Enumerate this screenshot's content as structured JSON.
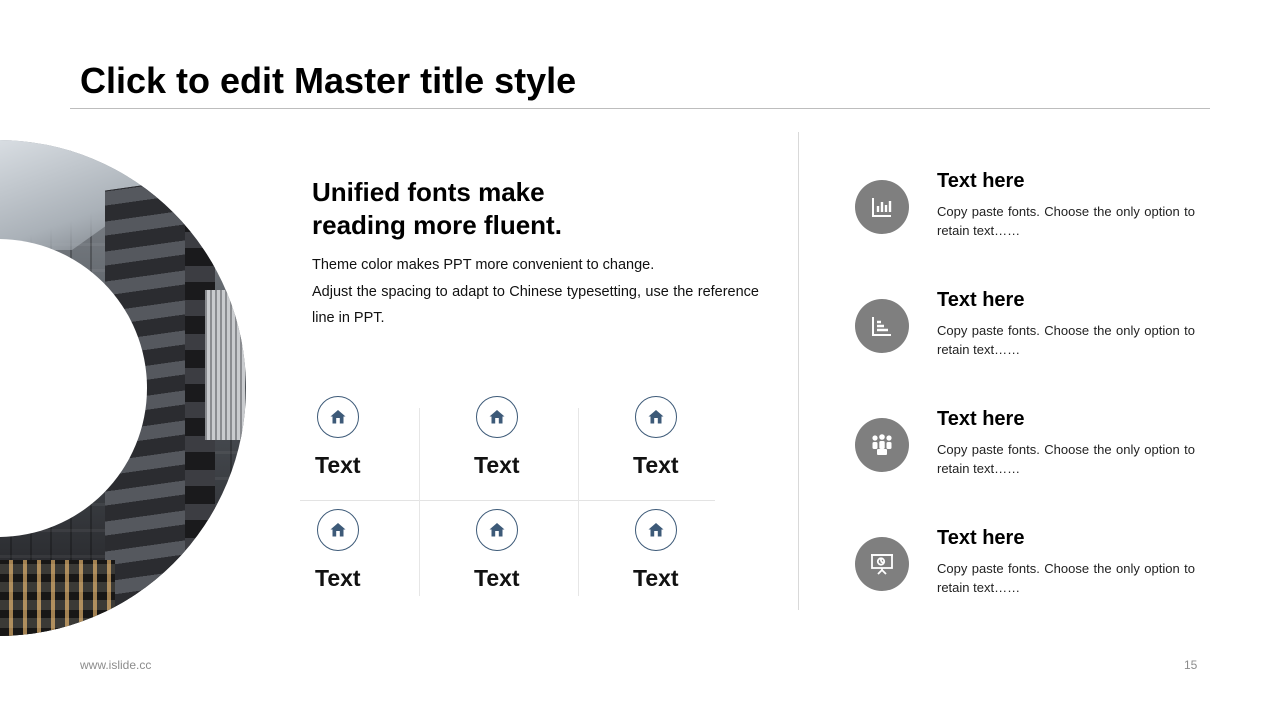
{
  "title": "Click to edit Master title style",
  "headline": [
    "Unified fonts make",
    "reading more fluent."
  ],
  "body": [
    "Theme color makes PPT more convenient to change.",
    "Adjust the spacing to adapt to Chinese typesetting, use the reference line in PPT."
  ],
  "grid": {
    "icon": "home-icon",
    "items": [
      {
        "label": "Text"
      },
      {
        "label": "Text"
      },
      {
        "label": "Text"
      },
      {
        "label": "Text"
      },
      {
        "label": "Text"
      },
      {
        "label": "Text"
      }
    ]
  },
  "list": [
    {
      "icon": "bar-chart-icon",
      "heading": "Text here",
      "text": "Copy paste fonts. Choose the only option to retain text……"
    },
    {
      "icon": "stairs-chart-icon",
      "heading": "Text here",
      "text": "Copy paste fonts. Choose the only option to retain text……"
    },
    {
      "icon": "team-icon",
      "heading": "Text here",
      "text": "Copy paste fonts. Choose the only option to retain text……"
    },
    {
      "icon": "presentation-icon",
      "heading": "Text here",
      "text": "Copy paste fonts. Choose the only option to retain text……"
    }
  ],
  "footer": {
    "website": "www.islide.cc",
    "page_number": "15"
  },
  "colors": {
    "icon_outline": "#3d5a78",
    "badge": "#7f7f7f",
    "rule": "#bdbdbd"
  }
}
